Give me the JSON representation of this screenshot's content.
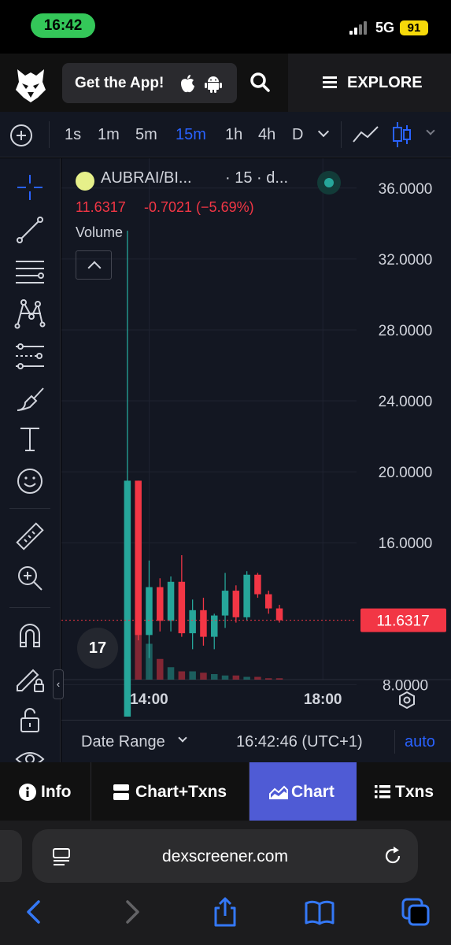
{
  "status": {
    "time": "16:42",
    "network": "5G",
    "battery": "91"
  },
  "topnav": {
    "get_app_label": "Get the App!",
    "explore_label": "EXPLORE"
  },
  "timeframes": [
    "1s",
    "1m",
    "5m",
    "15m",
    "1h",
    "4h",
    "D"
  ],
  "active_timeframe": "15m",
  "legend": {
    "pair": "AUBRAI/BI...",
    "interval": "· 15 · d...",
    "close": "11.6317",
    "change": "-0.7021 (−5.69%)",
    "volume_label": "Volume"
  },
  "tv_logo_text": "17",
  "sidebar_toggle": "‹",
  "range_bar": {
    "date_range": "Date Range",
    "clock": "16:42:46 (UTC+1)",
    "scale_mode": "auto"
  },
  "tabs": {
    "info": "Info",
    "chart_txns": "Chart+Txns",
    "chart": "Chart",
    "txns": "Txns"
  },
  "browser": {
    "url": "dexscreener.com"
  },
  "colors": {
    "up": "#26a69a",
    "down": "#f23645",
    "accent": "#2962ff",
    "active_tab": "#4f5bd5",
    "status_green": "#34c759"
  },
  "chart_data": {
    "type": "candlestick",
    "title": "",
    "y_ticks": [
      "36.0000",
      "32.0000",
      "28.0000",
      "24.0000",
      "20.0000",
      "16.0000",
      "8.0000"
    ],
    "ylim": [
      5.0,
      36.7
    ],
    "x_ticks": [
      {
        "label": "14:00",
        "t": 14.0
      },
      {
        "label": "18:00",
        "t": 18.0
      }
    ],
    "xlim": [
      11.98,
      20.95
    ],
    "last_price": 11.6317,
    "last_price_label": "11.6317",
    "grid": true,
    "candles": [
      {
        "t": 13.5,
        "o": 6.2,
        "h": 33.6,
        "l": 6.2,
        "c": 19.5
      },
      {
        "t": 13.75,
        "o": 19.5,
        "h": 19.5,
        "l": 10.5,
        "c": 10.8
      },
      {
        "t": 14.0,
        "o": 10.8,
        "h": 15.0,
        "l": 9.5,
        "c": 13.5
      },
      {
        "t": 14.25,
        "o": 13.5,
        "h": 14.0,
        "l": 11.0,
        "c": 11.6
      },
      {
        "t": 14.5,
        "o": 11.6,
        "h": 14.1,
        "l": 11.0,
        "c": 13.8
      },
      {
        "t": 14.75,
        "o": 13.8,
        "h": 15.3,
        "l": 10.7,
        "c": 10.9
      },
      {
        "t": 15.0,
        "o": 10.9,
        "h": 12.8,
        "l": 10.0,
        "c": 12.2
      },
      {
        "t": 15.25,
        "o": 12.2,
        "h": 12.9,
        "l": 10.2,
        "c": 10.7
      },
      {
        "t": 15.5,
        "o": 10.7,
        "h": 12.0,
        "l": 10.0,
        "c": 11.9
      },
      {
        "t": 15.75,
        "o": 11.9,
        "h": 14.3,
        "l": 11.2,
        "c": 13.3
      },
      {
        "t": 16.0,
        "o": 13.3,
        "h": 13.6,
        "l": 11.5,
        "c": 11.8
      },
      {
        "t": 16.25,
        "o": 11.8,
        "h": 14.4,
        "l": 11.6,
        "c": 14.2
      },
      {
        "t": 16.5,
        "o": 14.2,
        "h": 14.3,
        "l": 12.9,
        "c": 13.1
      },
      {
        "t": 16.75,
        "o": 13.1,
        "h": 13.3,
        "l": 12.0,
        "c": 12.3
      },
      {
        "t": 17.0,
        "o": 12.3,
        "h": 12.5,
        "l": 11.5,
        "c": 11.63
      }
    ],
    "volume": [
      15,
      40,
      26,
      15,
      9,
      6,
      6,
      5,
      4,
      3,
      3,
      2,
      2,
      1,
      1
    ]
  }
}
